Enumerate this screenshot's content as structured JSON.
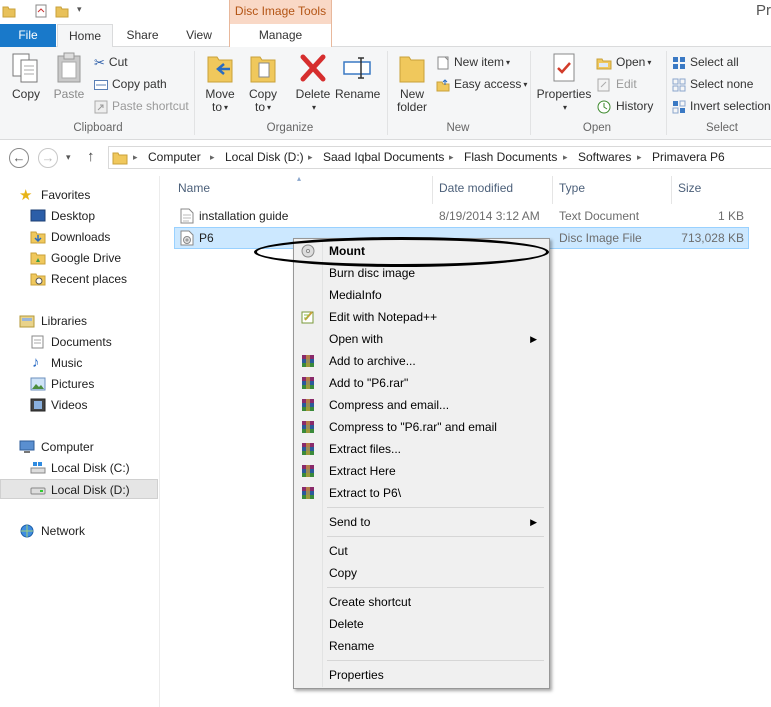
{
  "window": {
    "contextual_tab": "Disc Image Tools",
    "title_fragment": "Pri"
  },
  "tabs": {
    "file": "File",
    "home": "Home",
    "share": "Share",
    "view": "View",
    "manage": "Manage"
  },
  "ribbon": {
    "clipboard": {
      "copy": "Copy",
      "paste": "Paste",
      "cut": "Cut",
      "copy_path": "Copy path",
      "paste_shortcut": "Paste shortcut",
      "label": "Clipboard"
    },
    "organize": {
      "move_to_1": "Move",
      "move_to_2": "to",
      "copy_to_1": "Copy",
      "copy_to_2": "to",
      "delete": "Delete",
      "rename": "Rename",
      "label": "Organize"
    },
    "new": {
      "new_folder_1": "New",
      "new_folder_2": "folder",
      "new_item": "New item",
      "easy_access": "Easy access",
      "label": "New"
    },
    "open": {
      "properties": "Properties",
      "open": "Open",
      "edit": "Edit",
      "history": "History",
      "label": "Open"
    },
    "select": {
      "select_all": "Select all",
      "select_none": "Select none",
      "invert_selection": "Invert selection",
      "label": "Select"
    }
  },
  "address": {
    "crumbs": [
      "Computer",
      "Local Disk (D:)",
      "Saad Iqbal Documents",
      "Flash Documents",
      "Softwares",
      "Primavera P6"
    ]
  },
  "nav": {
    "favorites": "Favorites",
    "desktop": "Desktop",
    "downloads": "Downloads",
    "google_drive": "Google Drive",
    "recent_places": "Recent places",
    "libraries": "Libraries",
    "documents": "Documents",
    "music": "Music",
    "pictures": "Pictures",
    "videos": "Videos",
    "computer": "Computer",
    "local_c": "Local Disk (C:)",
    "local_d": "Local Disk (D:)",
    "network": "Network"
  },
  "columns": {
    "name": "Name",
    "date_modified": "Date modified",
    "type": "Type",
    "size": "Size"
  },
  "files": [
    {
      "name": "installation guide",
      "date": "8/19/2014 3:12 AM",
      "type": "Text Document",
      "size": "1 KB"
    },
    {
      "name": "P6",
      "date": "",
      "type": "Disc Image File",
      "size": "713,028 KB"
    }
  ],
  "context_menu": {
    "mount": "Mount",
    "burn": "Burn disc image",
    "mediainfo": "MediaInfo",
    "notepad": "Edit with Notepad++",
    "open_with": "Open with",
    "add_archive": "Add to archive...",
    "add_rar": "Add to \"P6.rar\"",
    "compress_email": "Compress and email...",
    "compress_rar_email": "Compress to \"P6.rar\" and email",
    "extract_files": "Extract files...",
    "extract_here": "Extract Here",
    "extract_to": "Extract to P6\\",
    "send_to": "Send to",
    "cut": "Cut",
    "copy": "Copy",
    "create_shortcut": "Create shortcut",
    "delete": "Delete",
    "rename": "Rename",
    "properties": "Properties"
  }
}
